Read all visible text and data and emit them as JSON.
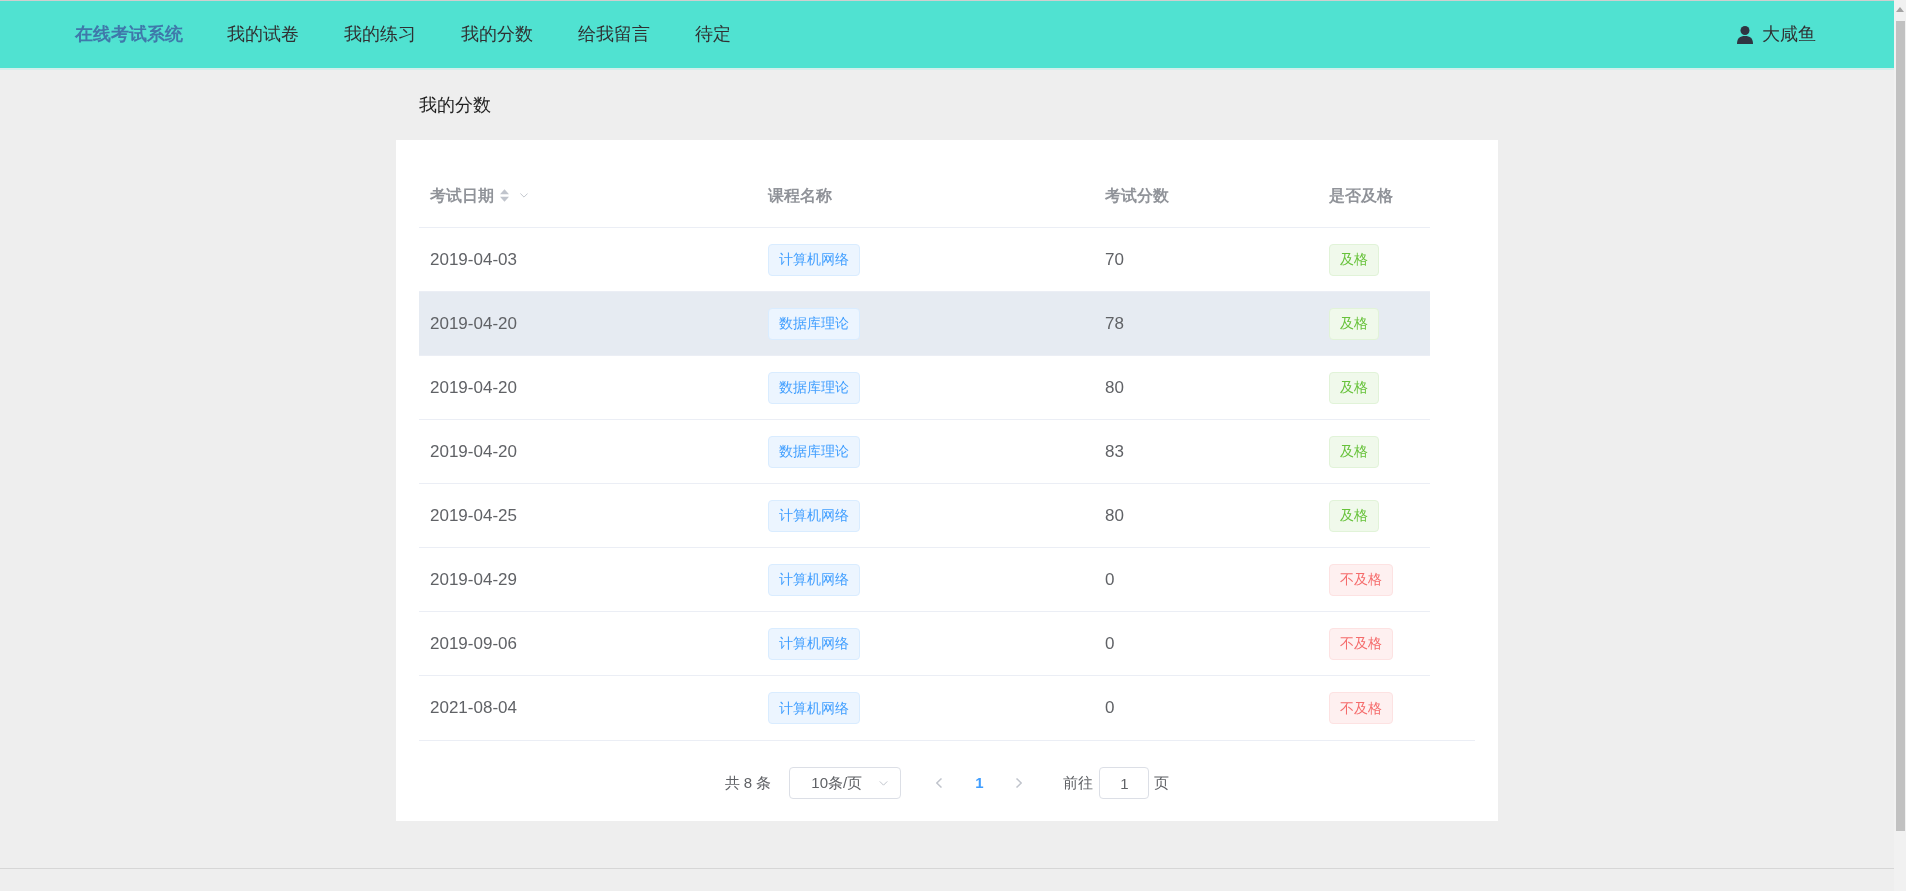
{
  "nav": {
    "logo": "在线考试系统",
    "items": [
      {
        "label": "我的试卷"
      },
      {
        "label": "我的练习"
      },
      {
        "label": "我的分数"
      },
      {
        "label": "给我留言"
      },
      {
        "label": "待定"
      }
    ],
    "user": {
      "name": "大咸鱼"
    }
  },
  "page_title": "我的分数",
  "table": {
    "columns": [
      {
        "label": "考试日期",
        "sortable": true,
        "filterable": true
      },
      {
        "label": "课程名称",
        "sortable": false,
        "filterable": false
      },
      {
        "label": "考试分数",
        "sortable": false,
        "filterable": false
      },
      {
        "label": "是否及格",
        "sortable": false,
        "filterable": false
      }
    ],
    "rows": [
      {
        "date": "2019-04-03",
        "course": "计算机网络",
        "score": "70",
        "result": {
          "label": "及格",
          "kind": "pass"
        },
        "hovered": false
      },
      {
        "date": "2019-04-20",
        "course": "数据库理论",
        "score": "78",
        "result": {
          "label": "及格",
          "kind": "pass"
        },
        "hovered": true
      },
      {
        "date": "2019-04-20",
        "course": "数据库理论",
        "score": "80",
        "result": {
          "label": "及格",
          "kind": "pass"
        },
        "hovered": false
      },
      {
        "date": "2019-04-20",
        "course": "数据库理论",
        "score": "83",
        "result": {
          "label": "及格",
          "kind": "pass"
        },
        "hovered": false
      },
      {
        "date": "2019-04-25",
        "course": "计算机网络",
        "score": "80",
        "result": {
          "label": "及格",
          "kind": "pass"
        },
        "hovered": false
      },
      {
        "date": "2019-04-29",
        "course": "计算机网络",
        "score": "0",
        "result": {
          "label": "不及格",
          "kind": "fail"
        },
        "hovered": false
      },
      {
        "date": "2019-09-06",
        "course": "计算机网络",
        "score": "0",
        "result": {
          "label": "不及格",
          "kind": "fail"
        },
        "hovered": false
      },
      {
        "date": "2021-08-04",
        "course": "计算机网络",
        "score": "0",
        "result": {
          "label": "不及格",
          "kind": "fail"
        },
        "hovered": false
      }
    ]
  },
  "pagination": {
    "total": "共 8 条",
    "page_size": "10条/页",
    "prev": {
      "disabled": true
    },
    "pages": [
      {
        "label": "1",
        "selected": true
      }
    ],
    "next": {
      "disabled": true
    },
    "goto_label": "前往",
    "goto_value": "1",
    "goto_suffix": "页"
  }
}
